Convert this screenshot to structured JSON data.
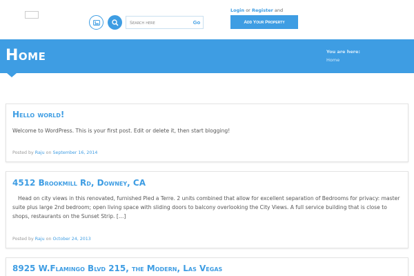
{
  "header": {
    "search_placeholder": "Search here",
    "go_label": "Go",
    "login_label": "Login",
    "or_text": "or",
    "register_label": "Register",
    "and_text": "and",
    "add_property_label": "Add Your Property"
  },
  "banner": {
    "title": "Home",
    "breadcrumb_label": "You are here:",
    "breadcrumb_current": "Home"
  },
  "posts": [
    {
      "title": "Hello world!",
      "excerpt": "Welcome to WordPress. This is your first post. Edit or delete it, then start blogging!",
      "posted_by_label": "Posted by",
      "author": "Raju",
      "on_label": "on",
      "date": "September 16, 2014"
    },
    {
      "title": "4512 Brookmill Rd, Downey, CA",
      "excerpt": "Head on city views in this renovated, furnished Pied a Terre. 2 units combined that allow for excellent separation of Bedrooms for privacy: master suite plus large 2nd bedroom; open living space with sliding doors to balcony overlooking the City Views. A full service building that is close to shops, restaurants on the Sunset Strip. […]",
      "posted_by_label": "Posted by",
      "author": "Raju",
      "on_label": "on",
      "date": "October 24, 2013"
    },
    {
      "title": "8925 W.Flamingo Blvd 215, the Modern, Las Vegas"
    }
  ],
  "colors": {
    "accent": "#3e9de3",
    "text": "#555555",
    "meta": "#999999"
  }
}
